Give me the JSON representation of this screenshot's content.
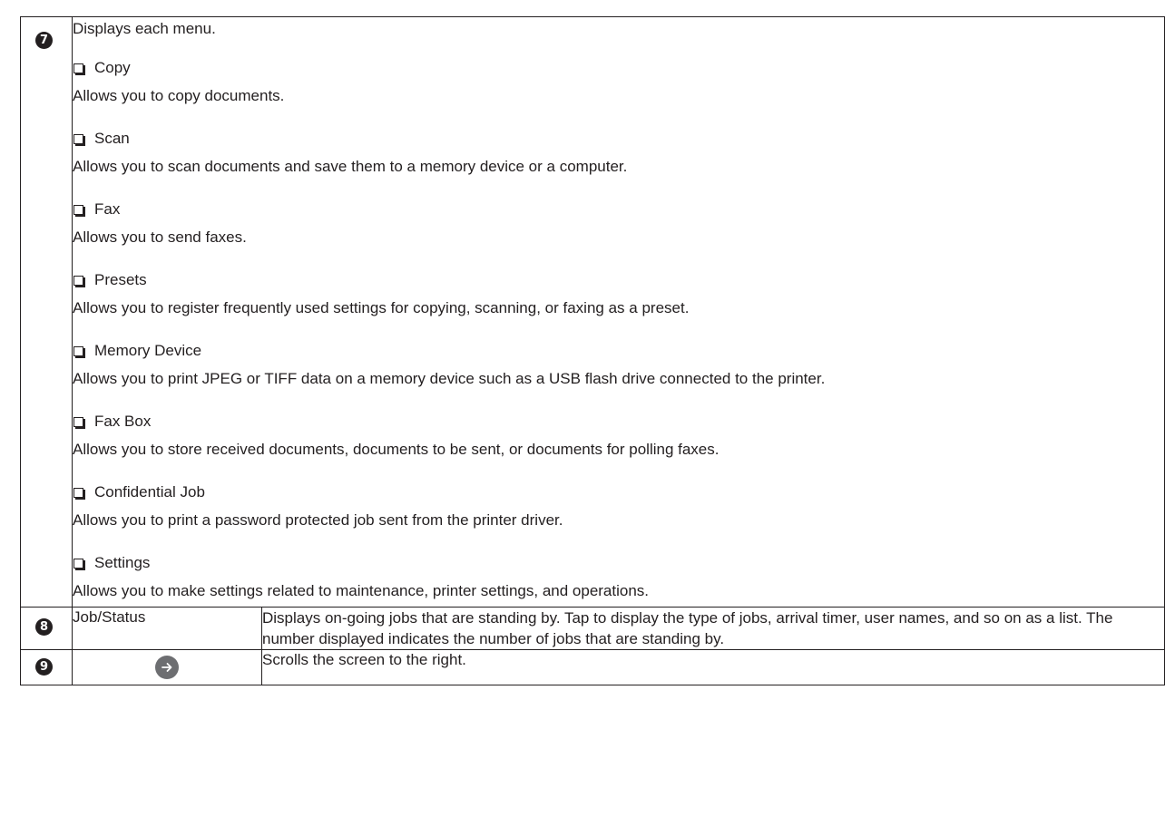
{
  "rows": [
    {
      "number": "7",
      "intro": "Displays each menu.",
      "menu_items": [
        {
          "label": "Copy",
          "description": "Allows you to copy documents."
        },
        {
          "label": "Scan",
          "description": "Allows you to scan documents and save them to a memory device or a computer."
        },
        {
          "label": "Fax",
          "description": "Allows you to send faxes."
        },
        {
          "label": "Presets",
          "description": "Allows you to register frequently used settings for copying, scanning, or faxing as a preset."
        },
        {
          "label": "Memory Device",
          "description": "Allows you to print JPEG or TIFF data on a memory device such as a USB flash drive connected to the printer."
        },
        {
          "label": "Fax Box",
          "description": "Allows you to store received documents, documents to be sent, or documents for polling faxes."
        },
        {
          "label": "Confidential Job",
          "description": "Allows you to print a password protected job sent from the printer driver."
        },
        {
          "label": "Settings",
          "description": "Allows you to make settings related to maintenance, printer settings, and operations."
        }
      ]
    },
    {
      "number": "8",
      "label": "Job/Status",
      "description": "Displays on-going jobs that are standing by. Tap to display the type of jobs, arrival timer, user names, and so on as a list. The number displayed indicates the number of jobs that are standing by."
    },
    {
      "number": "9",
      "icon": "right-arrow-icon",
      "description": "Scrolls the screen to the right."
    }
  ],
  "colors": {
    "text": "#231f20",
    "border": "#231f20",
    "arrow_circle": "#6d6e71"
  }
}
